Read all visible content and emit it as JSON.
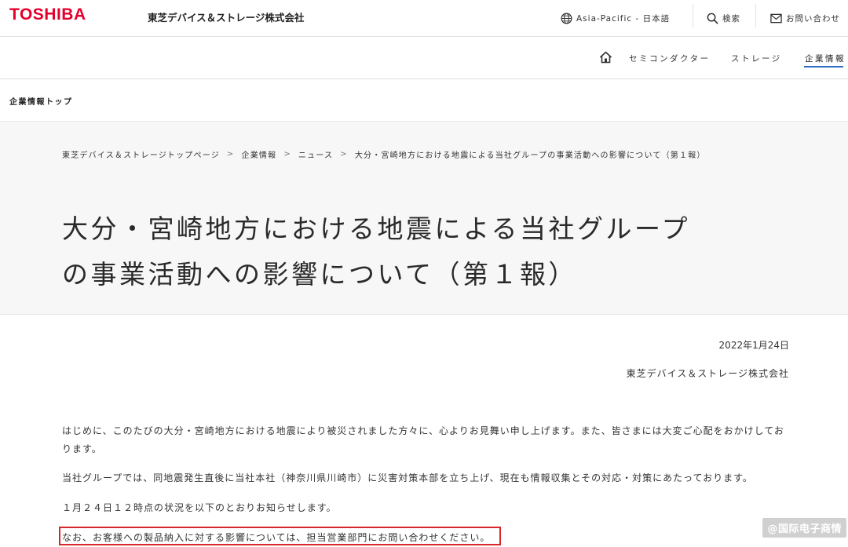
{
  "header": {
    "logo": "TOSHIBA",
    "company_name": "東芝デバイス＆ストレージ株式会社",
    "region_label": "Asia-Pacific - 日本語",
    "search_label": "検索",
    "contact_label": "お問い合わせ"
  },
  "global_nav": {
    "items": [
      {
        "label": "セミコンダクター"
      },
      {
        "label": "ストレージ"
      },
      {
        "label": "企業情報",
        "active": true
      }
    ]
  },
  "local_nav": {
    "title": "企業情報トップ"
  },
  "breadcrumb": [
    "東芝デバイス＆ストレージトップページ",
    "企業情報",
    "ニュース",
    "大分・宮崎地方における地震による当社グループの事業活動への影響について（第１報）"
  ],
  "article": {
    "title_line1": "大分・宮崎地方における地震による当社グループ",
    "title_line2": "の事業活動への影響について（第１報）",
    "date": "2022年1月24日",
    "issuer": "東芝デバイス＆ストレージ株式会社",
    "paragraphs": [
      "はじめに、このたびの大分・宮崎地方における地震により被災されました方々に、心よりお見舞い申し上げます。また、皆さまには大変ご心配をおかけしております。",
      "当社グループでは、同地震発生直後に当社本社（神奈川県川崎市）に災害対策本部を立ち上げ、現在も情報収集とその対応・対策にあたっております。",
      "１月２４日１２時点の状況を以下のとおりお知らせします。",
      "なお、お客様への製品納入に対する影響については、担当営業部門にお問い合わせください。"
    ]
  },
  "watermark": "@国际电子商情",
  "colors": {
    "brand_red": "#e4002b",
    "active_nav_underline": "#2b6cc4",
    "highlight_border": "#d9262a"
  }
}
